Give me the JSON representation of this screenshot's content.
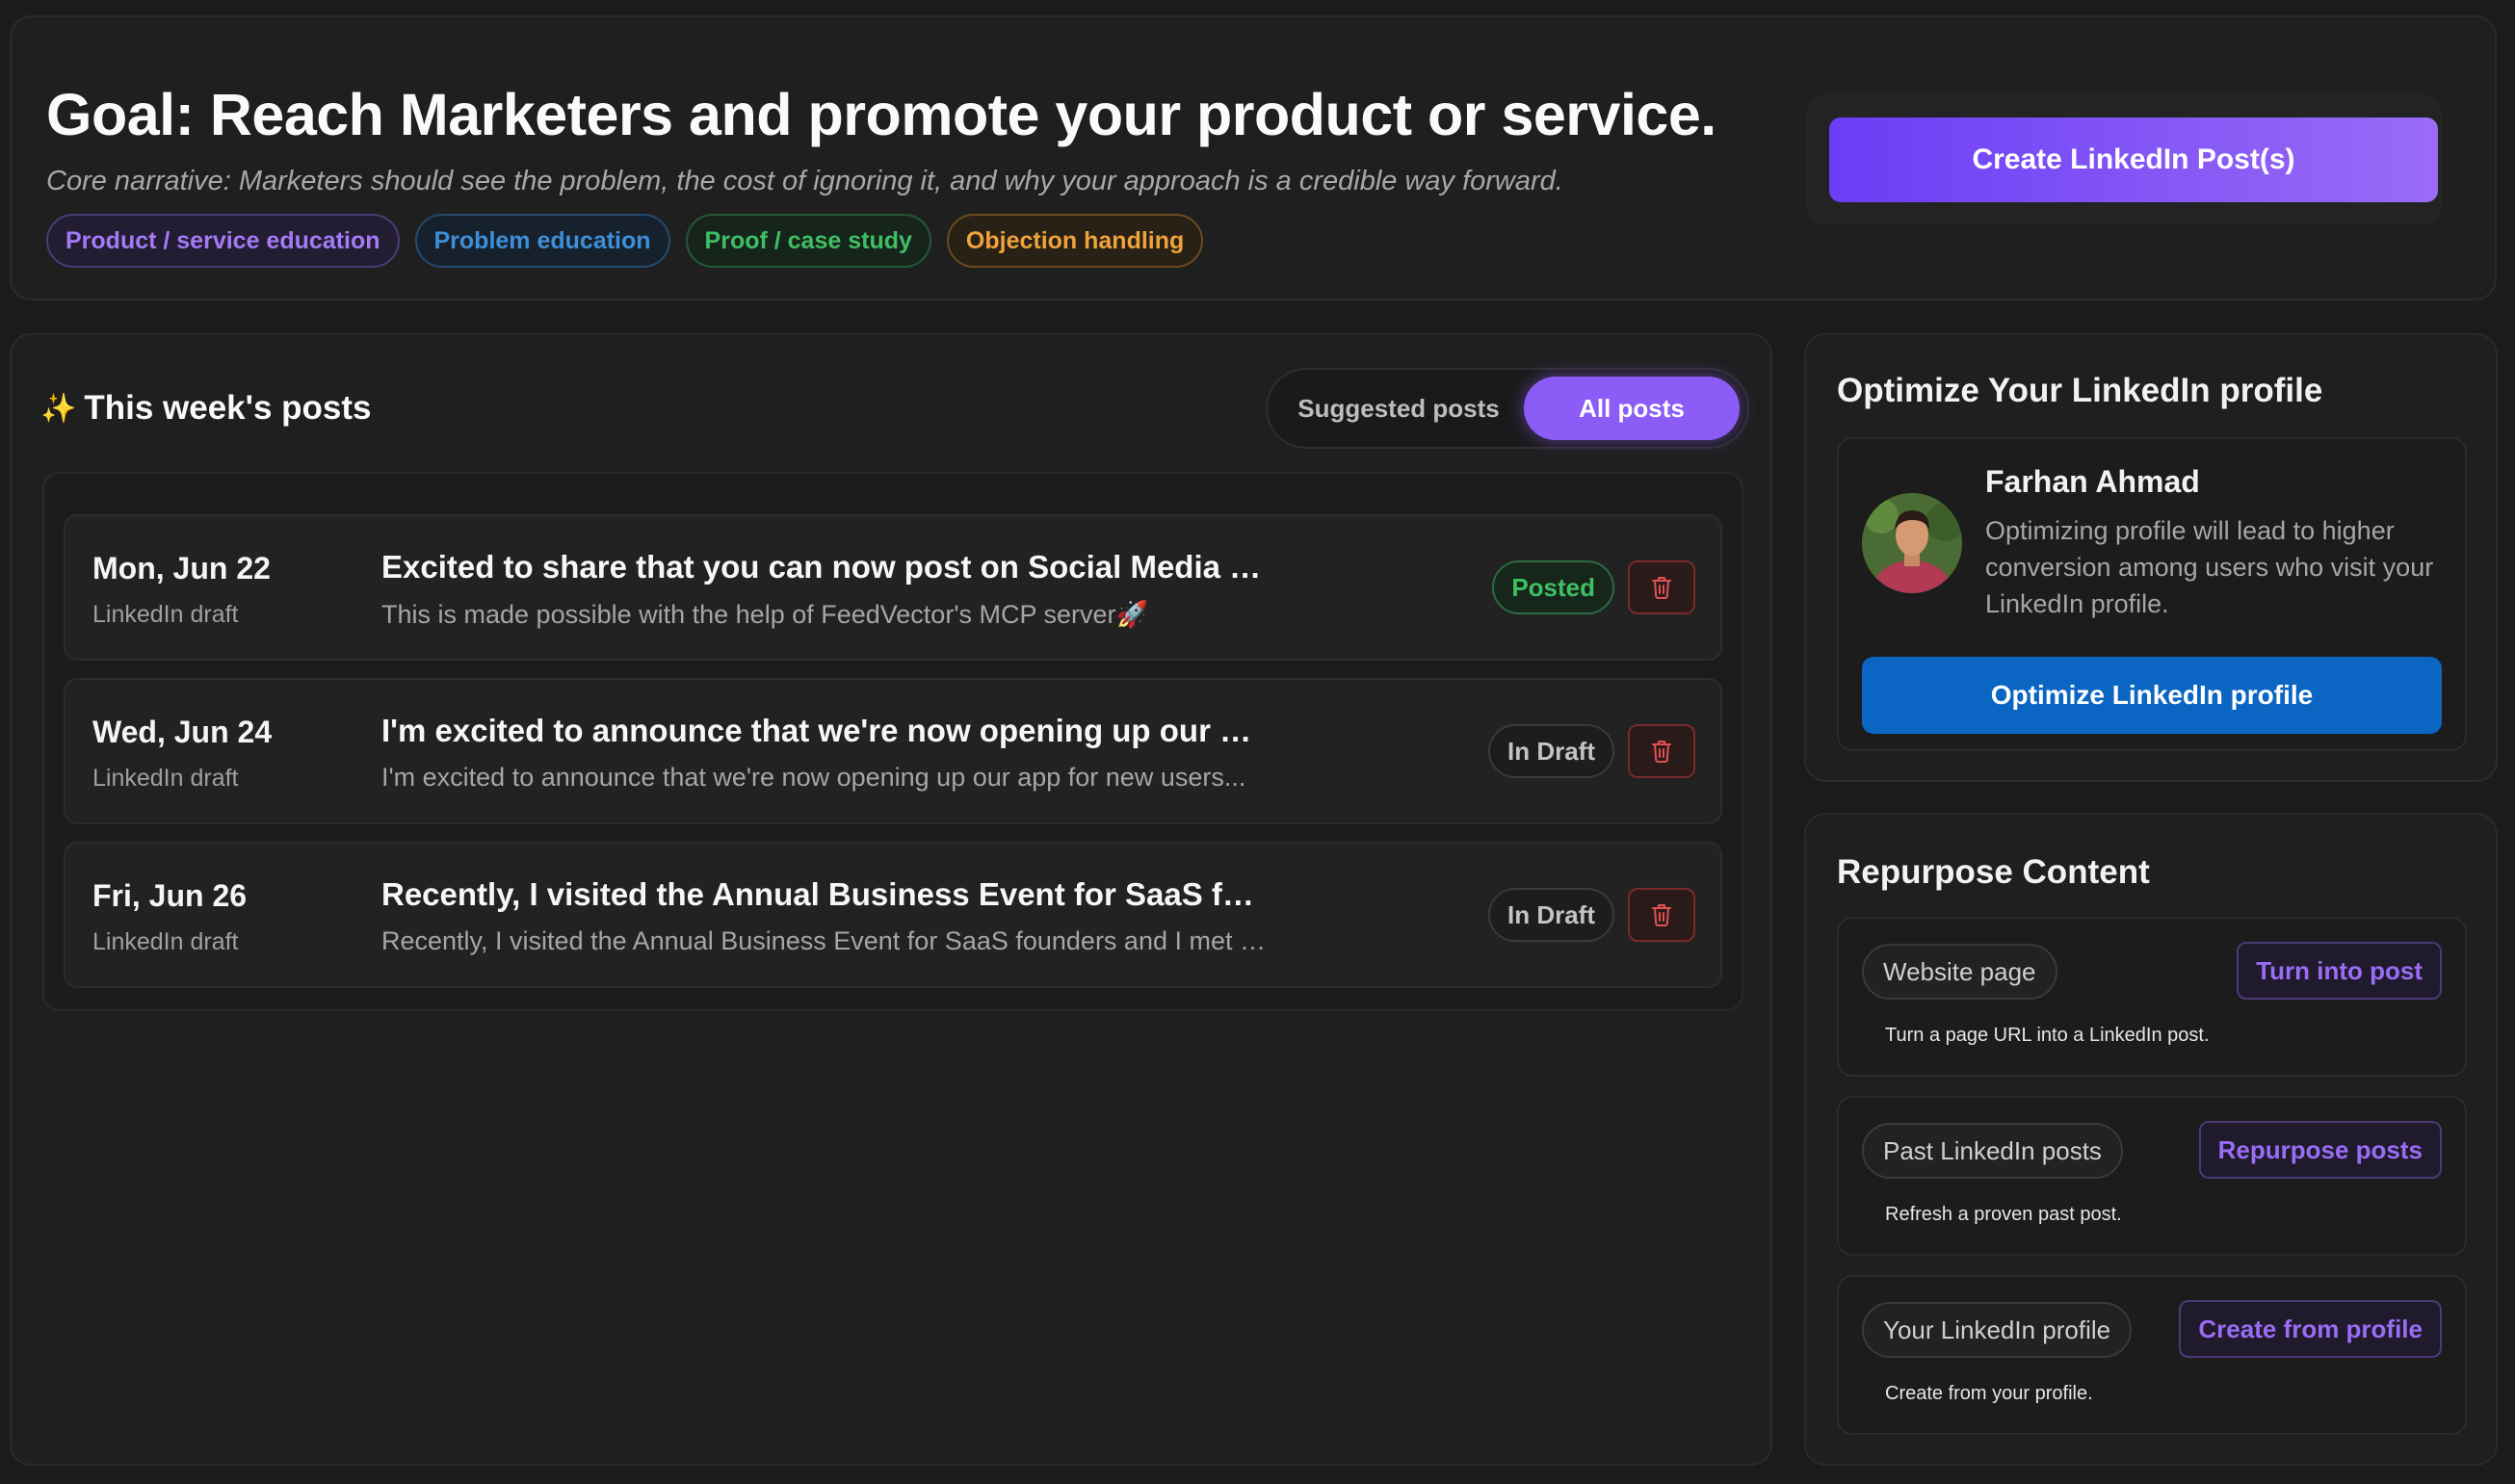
{
  "goal": {
    "title": "Goal: Reach Marketers and promote your product or service.",
    "narrative": "Core narrative: Marketers should see the problem, the cost of ignoring it, and why your approach is a credible way forward.",
    "tags": [
      "Product / service education",
      "Problem education",
      "Proof / case study",
      "Objection handling"
    ],
    "create_button": "Create LinkedIn Post(s)"
  },
  "posts": {
    "title": "This week's posts",
    "sparkle_icon": "sparkles-icon",
    "toggle": {
      "suggested": "Suggested posts",
      "all": "All posts",
      "active": "All posts"
    },
    "items": [
      {
        "date": "Mon, Jun 22",
        "type": "LinkedIn draft",
        "headline": "Excited to share that you can now post on Social Media directl...",
        "preview": "This is made possible with the help of FeedVector's MCP server🚀",
        "status": "Posted"
      },
      {
        "date": "Wed, Jun 24",
        "type": "LinkedIn draft",
        "headline": "I'm excited to announce that we're now opening up our app for...",
        "preview": "I'm excited to announce that we're now opening up our app for new users...",
        "status": "In Draft"
      },
      {
        "date": "Fri, Jun 26",
        "type": "LinkedIn draft",
        "headline": "Recently, I visited the Annual Business Event for SaaS founders ...",
        "preview": "Recently, I visited the Annual Business Event for SaaS founders and I met s...",
        "status": "In Draft"
      }
    ]
  },
  "optimize": {
    "title": "Optimize Your LinkedIn profile",
    "name": "Farhan Ahmad",
    "description": "Optimizing profile will lead to higher conversion among users who visit your LinkedIn profile.",
    "button": "Optimize LinkedIn profile"
  },
  "repurpose": {
    "title": "Repurpose Content",
    "items": [
      {
        "chip": "Website page",
        "action": "Turn into post",
        "description": "Turn a page URL into a LinkedIn post."
      },
      {
        "chip": "Past LinkedIn posts",
        "action": "Repurpose posts",
        "description": "Refresh a proven past post."
      },
      {
        "chip": "Your LinkedIn profile",
        "action": "Create from profile",
        "description": "Create from your profile."
      }
    ]
  },
  "colors": {
    "accent_purple": "#8b5cf6",
    "linkedin_blue": "#0a66c2",
    "posted_green": "#3fbf63",
    "delete_red": "#e05252"
  }
}
